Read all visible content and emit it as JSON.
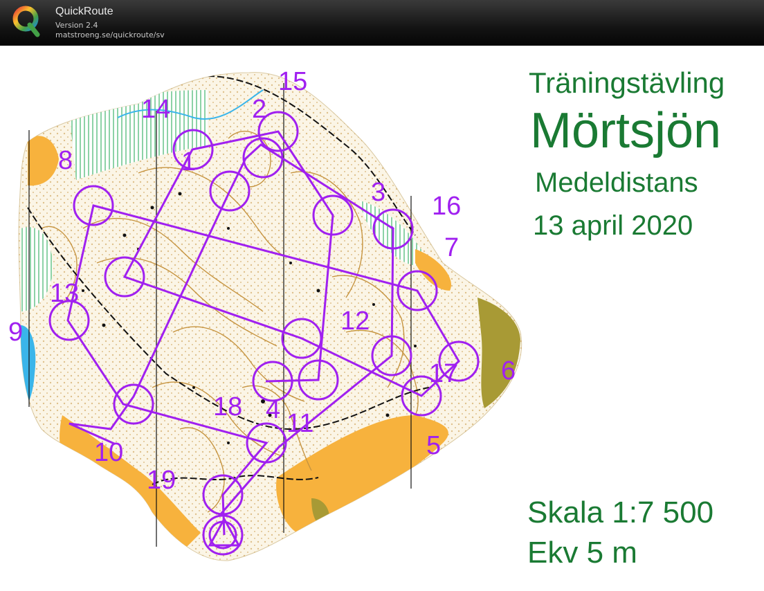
{
  "app": {
    "name": "QuickRoute",
    "version": "Version 2.4",
    "url": "matstroeng.se/quickroute/sv"
  },
  "map_info": {
    "subtitle": "Träningstävling",
    "title": "Mörtsjön",
    "type": "Medeldistans",
    "date": "13 april 2020",
    "scale": "Skala 1:7 500",
    "contour": "Ekv 5 m"
  },
  "colors": {
    "course": "#a020f0",
    "info_text": "#1a7a33",
    "map_base": "#fbf5e6",
    "contour": "#c69440",
    "open_land": "#f7b23d",
    "water": "#3ab5ea",
    "built_area": "#a89a35"
  },
  "course": {
    "controls": [
      {
        "id": "start",
        "label": ""
      },
      {
        "id": "c1",
        "label": "1"
      },
      {
        "id": "c2",
        "label": "2"
      },
      {
        "id": "c3",
        "label": "3"
      },
      {
        "id": "c4",
        "label": "4"
      },
      {
        "id": "c5",
        "label": "5"
      },
      {
        "id": "c6",
        "label": "6"
      },
      {
        "id": "c7",
        "label": "7"
      },
      {
        "id": "c8",
        "label": "8"
      },
      {
        "id": "c9",
        "label": "9"
      },
      {
        "id": "c10",
        "label": "10"
      },
      {
        "id": "c11",
        "label": "11"
      },
      {
        "id": "c12",
        "label": "12"
      },
      {
        "id": "c13",
        "label": "13"
      },
      {
        "id": "c14",
        "label": "14"
      },
      {
        "id": "c15",
        "label": "15"
      },
      {
        "id": "c16",
        "label": "16"
      },
      {
        "id": "c17",
        "label": "17"
      },
      {
        "id": "c18",
        "label": "18"
      },
      {
        "id": "c19",
        "label": "19"
      },
      {
        "id": "finish",
        "label": ""
      }
    ]
  }
}
